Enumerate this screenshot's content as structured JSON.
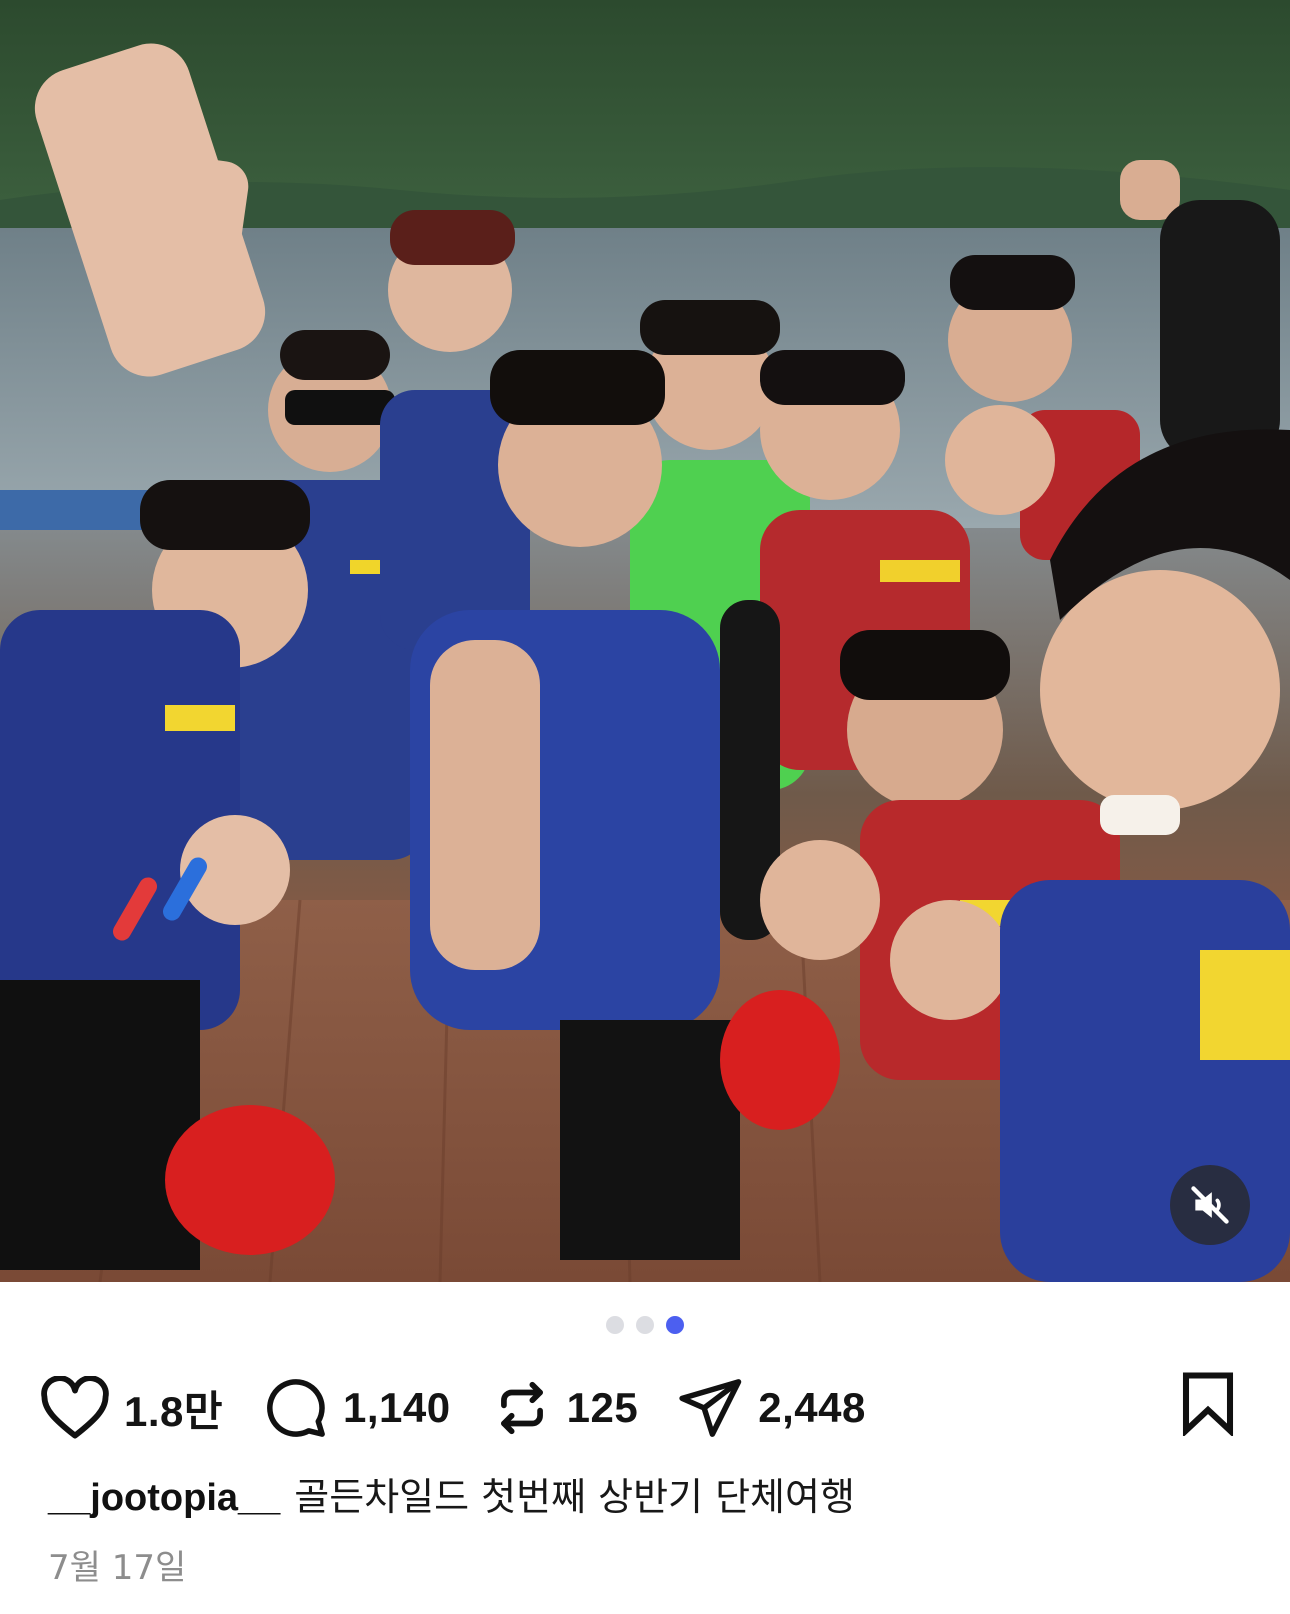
{
  "post": {
    "media": {
      "alt": "",
      "carousel_count": 3,
      "carousel_active_index": 2,
      "mute_icon": "speaker-muted-icon"
    },
    "actions": {
      "like": {
        "icon": "heart-outline-icon",
        "count": "1.8만"
      },
      "comment": {
        "icon": "comment-bubble-icon",
        "count": "1,140"
      },
      "repost": {
        "icon": "repost-arrows-icon",
        "count": "125"
      },
      "share": {
        "icon": "paper-plane-icon",
        "count": "2,448"
      },
      "bookmark": {
        "icon": "bookmark-outline-icon"
      }
    },
    "caption": {
      "username": "__jootopia__",
      "text": "골든차일드 첫번째 상반기 단체여행"
    },
    "date": "7월 17일"
  },
  "colors": {
    "active_dot": "#4c5ff0",
    "inactive_dot": "#dcdde2",
    "text": "#111111",
    "muted_text": "#8d8d8d"
  }
}
